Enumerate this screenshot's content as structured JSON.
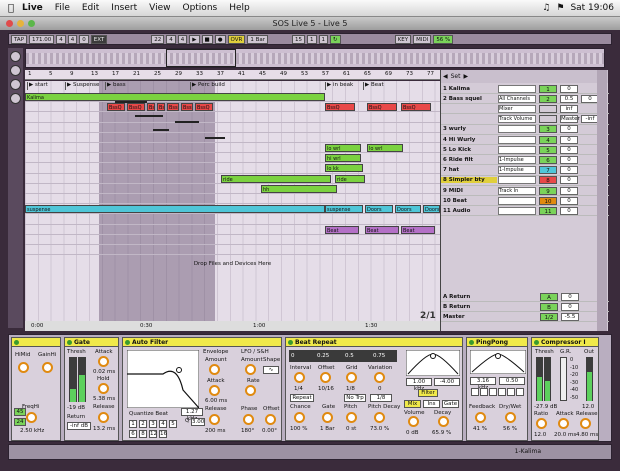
{
  "menubar": {
    "apple": "",
    "app": "Live",
    "items": [
      "File",
      "Edit",
      "Insert",
      "View",
      "Options",
      "Help"
    ],
    "clock": "Sat 19:06"
  },
  "window": {
    "title": "SOS Live 5 - Live 5"
  },
  "control": {
    "tap": "TAP",
    "tempo": "171.00",
    "sig_num": "4",
    "sig_den": "4",
    "quant": "0",
    "ext": "EXT",
    "position": "22",
    "beat": "4",
    "sub": "4",
    "ovr": "OVR",
    "loop_len": "1 Bar",
    "loop_start": "15",
    "loop_end": "1",
    "loop_sub": "1",
    "key": "KEY",
    "midi": "MIDI",
    "cpu": "56 %"
  },
  "ruler": {
    "bars": [
      "1",
      "5",
      "9",
      "13",
      "17",
      "21",
      "25",
      "29",
      "33",
      "37",
      "41",
      "45",
      "49",
      "53",
      "57",
      "61",
      "65",
      "69",
      "73",
      "77"
    ]
  },
  "markers": [
    "start",
    "Suspense",
    "bass",
    "Perc build",
    "in beak",
    "Beat"
  ],
  "clips": [
    {
      "label": "Kalima",
      "row": 0
    },
    {
      "label": "BssQ",
      "row": 1
    },
    {
      "label": "BssQ",
      "row": 1
    },
    {
      "label": "Bss",
      "row": 1
    },
    {
      "label": "Bss",
      "row": 1
    },
    {
      "label": "BssQ",
      "row": 1
    },
    {
      "label": "BssQ",
      "row": 1
    },
    {
      "label": "BssQ",
      "row": 1
    },
    {
      "label": "BssQ",
      "row": 1
    },
    {
      "label": "BssQ",
      "row": 1
    },
    {
      "label": "BssQ",
      "row": 1
    },
    {
      "label": "lo wrl",
      "row": 5
    },
    {
      "label": "lo wrl",
      "row": 5
    },
    {
      "label": "hi wrl",
      "row": 6
    },
    {
      "label": "lo kk",
      "row": 7
    },
    {
      "label": "ride",
      "row": 8
    },
    {
      "label": "ride",
      "row": 8
    },
    {
      "label": "hh",
      "row": 9
    },
    {
      "label": "suspense",
      "row": 10
    },
    {
      "label": "suspense",
      "row": 10
    },
    {
      "label": "Doors",
      "row": 10
    },
    {
      "label": "Doors",
      "row": 10
    },
    {
      "label": "Doors",
      "row": 10
    },
    {
      "label": "Beat",
      "row": 12
    },
    {
      "label": "Beat",
      "row": 12
    },
    {
      "label": "Beat",
      "row": 12
    }
  ],
  "drop_message": "Drop Files and Devices Here",
  "timeline": [
    "0:00",
    "0:30",
    "1:00",
    "1:30"
  ],
  "page_count": "2/1",
  "mixer": {
    "set_label": "Set",
    "tracks": [
      {
        "name": "1 Kalima",
        "num": "1",
        "routing": "",
        "vol": "0"
      },
      {
        "name": "2 Bass squel",
        "num": "2",
        "routing": "All Channels",
        "vol": "0.5",
        "vol2": "0"
      },
      {
        "name": "",
        "num": "",
        "routing": "Mixer",
        "vol": "inf",
        "vol2": ""
      },
      {
        "name": "",
        "num": "",
        "routing": "Track Volume",
        "vol": "Master",
        "vol2": "-inf"
      },
      {
        "name": "3 wurly",
        "num": "3",
        "routing": "",
        "vol": "0"
      },
      {
        "name": "4 Hi Wurly",
        "num": "4",
        "routing": "",
        "vol": "0"
      },
      {
        "name": "5 Lo Kick",
        "num": "5",
        "routing": "",
        "vol": "0"
      },
      {
        "name": "6 Ride filt",
        "num": "6",
        "routing": "1-Impulse",
        "vol": "0"
      },
      {
        "name": "7 hat",
        "num": "7",
        "routing": "1-Impulse",
        "vol": "0"
      },
      {
        "name": "8 Simpler bty",
        "num": "8",
        "routing": "",
        "vol": "0"
      },
      {
        "name": "9 MIDI",
        "num": "9",
        "routing": "Track In",
        "vol": "0"
      },
      {
        "name": "10 Beat",
        "num": "10",
        "routing": "",
        "vol": "0"
      },
      {
        "name": "11 Audio",
        "num": "11",
        "routing": "",
        "vol": "0"
      }
    ],
    "returns": [
      {
        "name": "A Return",
        "letter": "A",
        "vol": "0"
      },
      {
        "name": "B Return",
        "letter": "B",
        "vol": "0"
      },
      {
        "name": "Master",
        "letter": "1/2",
        "vol": "-5.5"
      }
    ]
  },
  "devices": {
    "simpler": {
      "labels": [
        "HiMid",
        "GainHi",
        "FreqHi",
        "2.50 kHz",
        "45",
        "24"
      ]
    },
    "gate": {
      "name": "Gate",
      "thresh": "Thresh",
      "thresh_val": "-19 dB",
      "attack": "Attack",
      "attack_val": "0.02 ms",
      "hold": "Hold",
      "hold_val": "5.38 ms",
      "release": "Release",
      "release_val": "13.2 ms",
      "return": "Return",
      "return_val": "-inf dB"
    },
    "autofilter": {
      "name": "Auto Filter",
      "envelope": "Envelope",
      "amount": "Amount",
      "attack": "Attack",
      "attack_val": "6.00 ms",
      "release": "Release",
      "release_val": "200 ms",
      "lfo": "LFO / S&H",
      "shape": "Shape",
      "rate": "Rate",
      "rate_val": "1.27 kHz",
      "phase": "Phase",
      "phase_val": "180°",
      "offset": "Offset",
      "offset_val": "0.00°",
      "q": "Q",
      "q_val": "3.00",
      "quantize": "Quantize Beat",
      "qbtns": [
        "1",
        "2",
        "3",
        "4",
        "5",
        "6",
        "8",
        "12",
        "16"
      ]
    },
    "beatrepeat": {
      "name": "Beat Repeat",
      "scale": [
        "0",
        "0.25",
        "0.5",
        "0.75"
      ],
      "interval": "Interval",
      "interval_val": "1/4",
      "offset": "Offset",
      "offset_val": "10/16",
      "grid": "Grid",
      "grid_val": "1/8",
      "variation": "Variation",
      "variation_val": "0",
      "repeat": "Repeat",
      "notrip": "No Trp",
      "trip_val": "1/8",
      "freq": "1.00 kHz",
      "gain_val": "-4.00",
      "filter": "Filter",
      "chance": "Chance",
      "chance_val": "100 %",
      "gate": "Gate",
      "gate_val": "1 Bar",
      "pitch": "Pitch",
      "pitch_val": "0 st",
      "pitchdecay": "Pitch Decay",
      "pitchdecay_val": "73.0 %",
      "volume": "Volume",
      "volume_val": "0 dB",
      "decay": "Decay",
      "decay_val": "65.9 %",
      "modes": [
        "Mix",
        "Ins",
        "Gate"
      ]
    },
    "pingpong": {
      "name": "PingPong",
      "freq": "3.16 kHz",
      "width": "0.50",
      "feedback": "Feedback",
      "feedback_val": "41 %",
      "drywet": "Dry/Wet",
      "drywet_val": "56 %"
    },
    "compressor": {
      "name": "Compressor I",
      "thresh": "Thresh",
      "thresh_val": "-27.9 dB",
      "gr": "G.R.",
      "out": "Out",
      "out_val": "12.0",
      "ratio": "Ratio",
      "ratio_val": "12.0",
      "attack": "Attack",
      "attack_val": "20.0 ms",
      "release": "Release",
      "release_val": "4.80 ms",
      "scale": [
        "0",
        "-10",
        "-20",
        "-30",
        "-40",
        "-50"
      ]
    }
  },
  "status": {
    "track": "1-Kalima"
  },
  "colors": {
    "kalima": "#7bd240",
    "bss": "#e84848",
    "wurly": "#7bd240",
    "cyan": "#4fc6d8",
    "beat": "#b470c7",
    "yellow": "#f0e94a",
    "orange": "#e08a10"
  }
}
